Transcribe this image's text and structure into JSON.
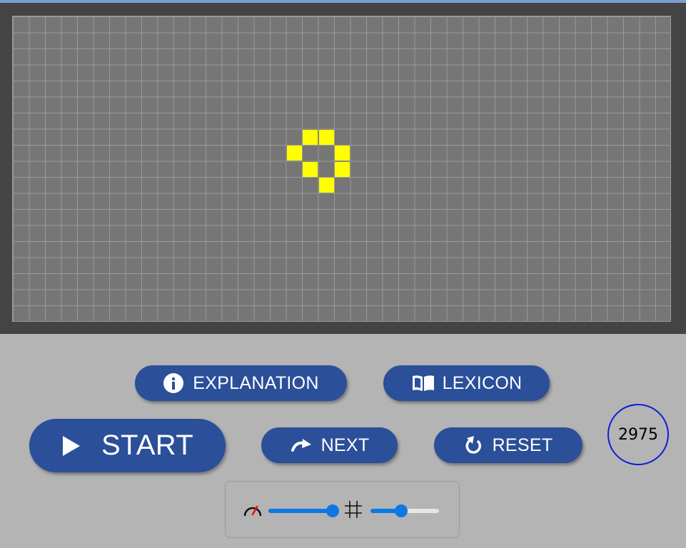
{
  "board": {
    "live_cells": [
      [
        18,
        7
      ],
      [
        19,
        7
      ],
      [
        17,
        8
      ],
      [
        20,
        8
      ],
      [
        18,
        9
      ],
      [
        20,
        9
      ],
      [
        19,
        10
      ]
    ],
    "cell_color": "#ffff00",
    "grid_color": "#767676",
    "frame_color": "#444444"
  },
  "buttons": {
    "explanation": {
      "label": "EXPLANATION",
      "icon": "info-icon"
    },
    "lexicon": {
      "label": "LEXICON",
      "icon": "book-icon"
    },
    "start": {
      "label": "START",
      "icon": "play-icon"
    },
    "next": {
      "label": "NEXT",
      "icon": "redo-arrow-icon"
    },
    "reset": {
      "label": "RESET",
      "icon": "reset-icon"
    },
    "color": "#2b4f99"
  },
  "generation_counter": "2975",
  "sliders": {
    "speed": {
      "icon": "speedometer-icon",
      "level": 1.0
    },
    "grid_size": {
      "icon": "grid-icon",
      "level": 0.45
    },
    "accent": "#0b78e3"
  }
}
